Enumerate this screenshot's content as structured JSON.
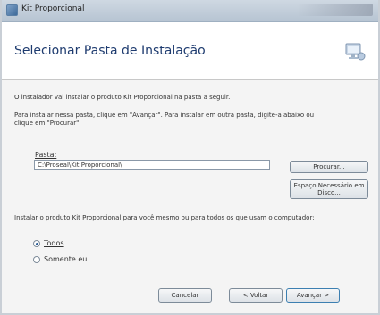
{
  "window": {
    "title": "Kit Proporcional"
  },
  "header": {
    "title": "Selecionar Pasta de Instalação"
  },
  "body": {
    "intro": "O instalador vai instalar o produto Kit Proporcional na pasta a seguir.",
    "instruction_line1": "Para instalar nessa pasta, clique em \"Avançar\". Para instalar em outra pasta, digite-a abaixo ou",
    "instruction_line2": "clique em \"Procurar\"."
  },
  "folder": {
    "label": "Pasta:",
    "value": "C:\\Proseal\\Kit Proporcional\\",
    "browse_button": "Procurar...",
    "disk_cost_line1": "Espaço Necessário em",
    "disk_cost_line2": "Disco..."
  },
  "install_for": {
    "prompt": "Instalar o produto Kit Proporcional para você mesmo ou para todos os que usam o computador:",
    "options": [
      {
        "label": "Todos",
        "checked": true
      },
      {
        "label": "Somente eu",
        "checked": false
      }
    ]
  },
  "footer": {
    "cancel": "Cancelar",
    "back": "< Voltar",
    "next": "Avançar >"
  }
}
